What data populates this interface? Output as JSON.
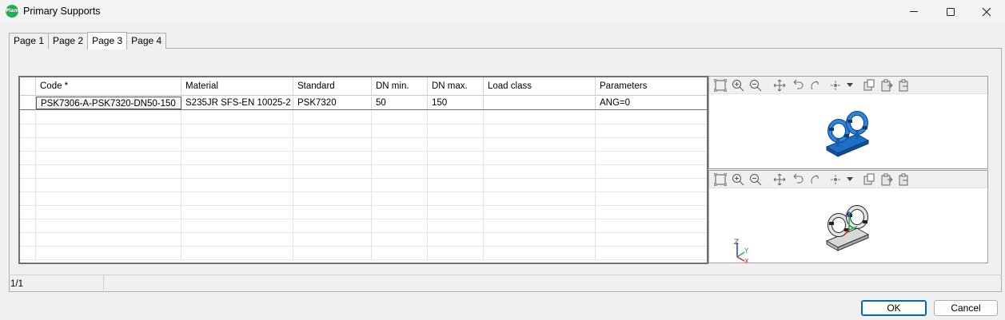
{
  "window": {
    "title": "Primary Supports",
    "app_icon_text": "Plant"
  },
  "tabs": [
    {
      "label": "Page 1"
    },
    {
      "label": "Page 2"
    },
    {
      "label": "Page 3"
    },
    {
      "label": "Page 4"
    }
  ],
  "active_tab": "Page 3",
  "grid": {
    "columns": [
      "Code *",
      "Material",
      "Standard",
      "DN min.",
      "DN max.",
      "Load class",
      "Parameters"
    ],
    "rows": [
      {
        "code": "PSK7306-A-PSK7320-DN50-150",
        "material": "S235JR SFS-EN 10025-2",
        "standard": "PSK7320",
        "dn_min": "50",
        "dn_max": "150",
        "load_class": "",
        "parameters": "ANG=0"
      }
    ]
  },
  "views": {
    "top_toolbar": [
      "zoom-extents-icon",
      "zoom-in-icon",
      "zoom-out-icon",
      "pan-icon",
      "rotate-left-icon",
      "rotate-right-icon",
      "view-point-icon",
      "dropdown-icon",
      "copy-icon",
      "paste-icon",
      "export-icon"
    ],
    "axis_labels": {
      "z": "Z",
      "y": "Y",
      "x": "X"
    }
  },
  "status": {
    "record_count": "1/1"
  },
  "buttons": {
    "ok": "OK",
    "cancel": "Cancel"
  },
  "colors": {
    "support_blue": "#1e6fc7",
    "support_grey": "#d8d8d8",
    "accent": "#0067c0"
  }
}
